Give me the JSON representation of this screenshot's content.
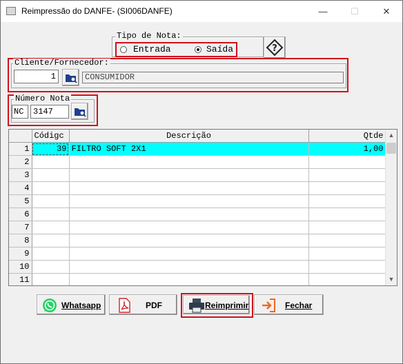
{
  "window": {
    "title": "Reimpressão do DANFE- (SI006DANFE)",
    "minimize_glyph": "—",
    "maximize_glyph": "☐",
    "close_glyph": "✕"
  },
  "tipo_nota": {
    "legend": "Tipo de Nota:",
    "options": [
      {
        "label": "Entrada",
        "selected": false
      },
      {
        "label": "Saída",
        "selected": true
      }
    ]
  },
  "help_button": {
    "icon": "diamond-question-icon",
    "glyph": "?"
  },
  "cliente": {
    "legend": "Cliente/Fornecedor:",
    "code": "1",
    "name": "CONSUMIDOR",
    "lookup_icon": "folder-search-icon"
  },
  "numero_nota": {
    "legend": "Número Nota",
    "series": "NC",
    "number": "3147",
    "lookup_icon": "folder-search-icon"
  },
  "grid": {
    "columns": [
      "Códigc",
      "Descrição",
      "Qtde"
    ],
    "rows": [
      {
        "n": "1",
        "codigo": "39",
        "descricao": "FILTRO SOFT 2X1",
        "qtde": "1,00"
      },
      {
        "n": "2",
        "codigo": "",
        "descricao": "",
        "qtde": ""
      },
      {
        "n": "3",
        "codigo": "",
        "descricao": "",
        "qtde": ""
      },
      {
        "n": "4",
        "codigo": "",
        "descricao": "",
        "qtde": ""
      },
      {
        "n": "5",
        "codigo": "",
        "descricao": "",
        "qtde": ""
      },
      {
        "n": "6",
        "codigo": "",
        "descricao": "",
        "qtde": ""
      },
      {
        "n": "7",
        "codigo": "",
        "descricao": "",
        "qtde": ""
      },
      {
        "n": "8",
        "codigo": "",
        "descricao": "",
        "qtde": ""
      },
      {
        "n": "9",
        "codigo": "",
        "descricao": "",
        "qtde": ""
      },
      {
        "n": "10",
        "codigo": "",
        "descricao": "",
        "qtde": ""
      },
      {
        "n": "11",
        "codigo": "",
        "descricao": "",
        "qtde": ""
      }
    ]
  },
  "buttons": {
    "whatsapp": {
      "label": "Whatsapp",
      "icon": "whatsapp-icon"
    },
    "pdf": {
      "label": "PDF",
      "icon": "pdf-icon"
    },
    "reimprimir": {
      "label": "Reimprimir",
      "icon": "printer-icon"
    },
    "fechar": {
      "label": "Fechar",
      "icon": "exit-icon"
    }
  },
  "colors": {
    "highlight": "#d0101a",
    "selected_row": "#00ffff",
    "whatsapp_green": "#25d366",
    "pdf_red": "#d2232a",
    "exit_orange": "#f26522"
  }
}
